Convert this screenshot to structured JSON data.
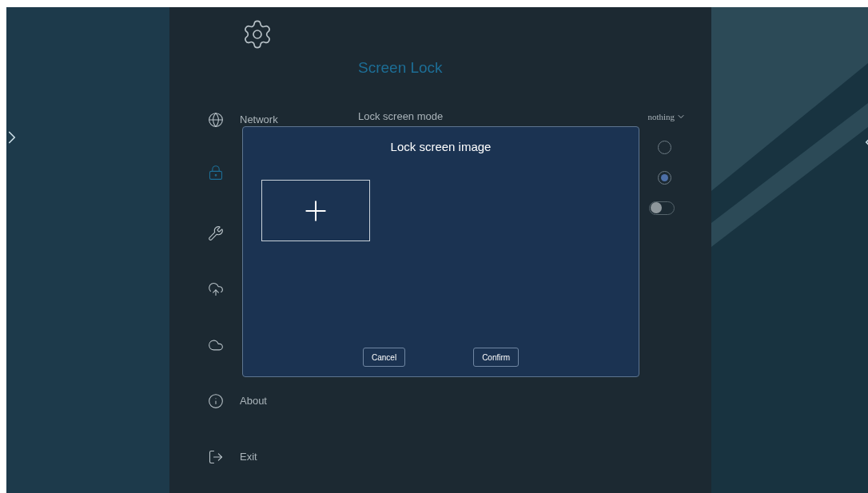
{
  "title": "Screen Lock",
  "sidebar": {
    "items": [
      {
        "kind": "network",
        "label": "Network",
        "selected": false
      },
      {
        "kind": "lock",
        "selected": true
      },
      {
        "kind": "tools",
        "selected": false
      },
      {
        "kind": "update",
        "selected": false
      },
      {
        "kind": "recovery",
        "selected": false
      },
      {
        "kind": "about",
        "label": "About",
        "selected": false
      },
      {
        "kind": "exit",
        "label": "Exit",
        "selected": false
      }
    ]
  },
  "settings": [
    {
      "kind": "dropdown",
      "label": "Lock screen mode",
      "value": "nothing"
    },
    {
      "kind": "radio",
      "selected": false
    },
    {
      "kind": "radio",
      "selected": true
    },
    {
      "kind": "toggle",
      "on": false
    }
  ],
  "dialog": {
    "title": "Lock screen image",
    "buttons": [
      "Cancel",
      "Confirm"
    ]
  }
}
